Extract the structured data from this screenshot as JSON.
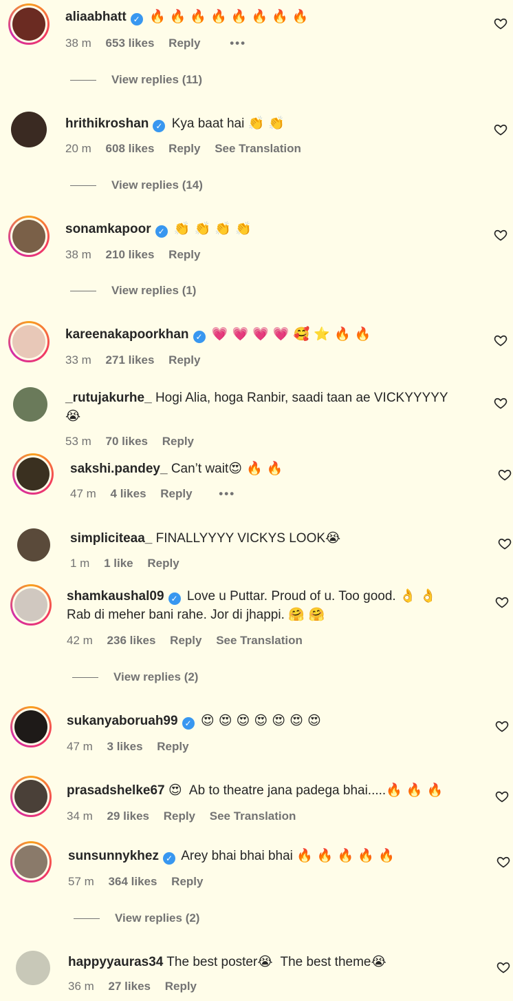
{
  "labels": {
    "reply": "Reply",
    "see_translation": "See Translation",
    "more": "•••"
  },
  "comments": [
    {
      "username": "aliaabhatt",
      "text": "",
      "emoji": "🔥 🔥 🔥 🔥 🔥 🔥 🔥 🔥",
      "time": "38 m",
      "likes": "653 likes",
      "view_replies": "View replies (11)"
    },
    {
      "username": "hrithikroshan",
      "text": "Kya baat hai",
      "emoji": "👏 👏",
      "time": "20 m",
      "likes": "608 likes",
      "view_replies": "View replies (14)"
    },
    {
      "username": "sonamkapoor",
      "text": "",
      "emoji": "👏 👏 👏 👏",
      "time": "38 m",
      "likes": "210 likes",
      "view_replies": "View replies (1)"
    },
    {
      "username": "kareenakapoorkhan",
      "text": "",
      "emoji": "💗 💗 💗 💗 🥰 ⭐ 🔥 🔥",
      "time": "33 m",
      "likes": "271 likes"
    },
    {
      "username": "_rutujakurhe_",
      "text": "Hogi Alia, hoga Ranbir, saadi taan ae VICKYYYYY",
      "emoji": "😭",
      "time": "53 m",
      "likes": "70 likes"
    },
    {
      "username": "sakshi.pandey_",
      "text": "Can’t wait",
      "emoji": "😍 🔥 🔥",
      "time": "47 m",
      "likes": "4 likes"
    },
    {
      "username": "simpliciteaa_",
      "text": "FINALLYYYY VICKYS LOOK",
      "emoji": "😭",
      "time": "1 m",
      "likes": "1 like"
    },
    {
      "username": "shamkaushal09",
      "text": "Love u Puttar. Proud of u. Too good.",
      "emoji": "👌 👌",
      "text2": "Rab di meher bani rahe. Jor di jhappi.",
      "emoji2": "🤗 🤗",
      "time": "42 m",
      "likes": "236 likes",
      "view_replies": "View replies (2)"
    },
    {
      "username": "sukanyaboruah99",
      "text": "",
      "emoji": "😍 😍 😍 😍 😍 😍 😍",
      "time": "47 m",
      "likes": "3 likes"
    },
    {
      "username": "prasadshelke67",
      "text": "Ab to theatre jana padega bhai.....",
      "emoji_before": "😍",
      "emoji": "🔥 🔥 🔥",
      "time": "34 m",
      "likes": "29 likes"
    },
    {
      "username": "sunsunnykhez",
      "text": "Arey bhai bhai bhai",
      "emoji": "🔥 🔥 🔥 🔥 🔥",
      "time": "57 m",
      "likes": "364 likes",
      "view_replies": "View replies (2)"
    },
    {
      "username": "happyyauras34",
      "text": "The best poster",
      "emoji": "😭",
      "text2": "The best theme",
      "emoji2": "😭",
      "time": "36 m",
      "likes": "27 likes"
    }
  ],
  "colors": {
    "background": "#fffde9",
    "secondary_text": "#737373",
    "verified": "#3897f0"
  }
}
